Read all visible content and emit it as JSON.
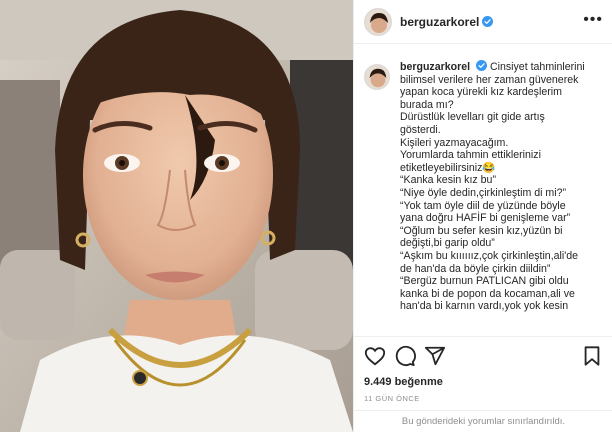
{
  "post": {
    "username": "berguzarkorel",
    "more_label": "•••"
  },
  "caption": {
    "lines": [
      "Cinsiyet tahminlerini",
      "bilimsel verilere her zaman güvenerek",
      "yapan koca yürekli kız kardeşlerim",
      "burada mı?",
      "Dürüstlük levelları git gide artış",
      "gösterdi.",
      "Kişileri yazmayacağım.",
      "Yorumlarda tahmin ettiklerinizi",
      "etiketleyebilirsiniz😂",
      "“Kanka kesin kız bu”",
      "“Niye öyle dedin,çirkinleştim di mi?”",
      "“Yok tam öyle diil de yüzünde böyle",
      "yana doğru HAFİF bi genişleme var”",
      "“Oğlum bu sefer kesin kız,yüzün bi",
      "değişti,bi garip oldu”",
      "“Aşkım bu kıııııız,çok çirkinleştin,ali'de",
      "de han'da da böyle çirkin diildin”",
      "“Bergüz burnun PATLICAN gibi oldu",
      "kanka bi de popon da kocaman,ali ve",
      "han'da bi karnın vardı,yok yok kesin"
    ]
  },
  "actions": {
    "like_icon": "heart-icon",
    "comment_icon": "comment-icon",
    "share_icon": "share-icon",
    "save_icon": "bookmark-icon"
  },
  "stats": {
    "likes": "9.449 beğenme",
    "time": "11 GÜN ÖNCE"
  },
  "comments": {
    "limited_text": "Bu gönderideki yorumlar sınırlandırıldı."
  },
  "colors": {
    "verified": "#3897f0",
    "text": "#262626",
    "muted": "#8e8e8e",
    "border": "#efefef"
  }
}
